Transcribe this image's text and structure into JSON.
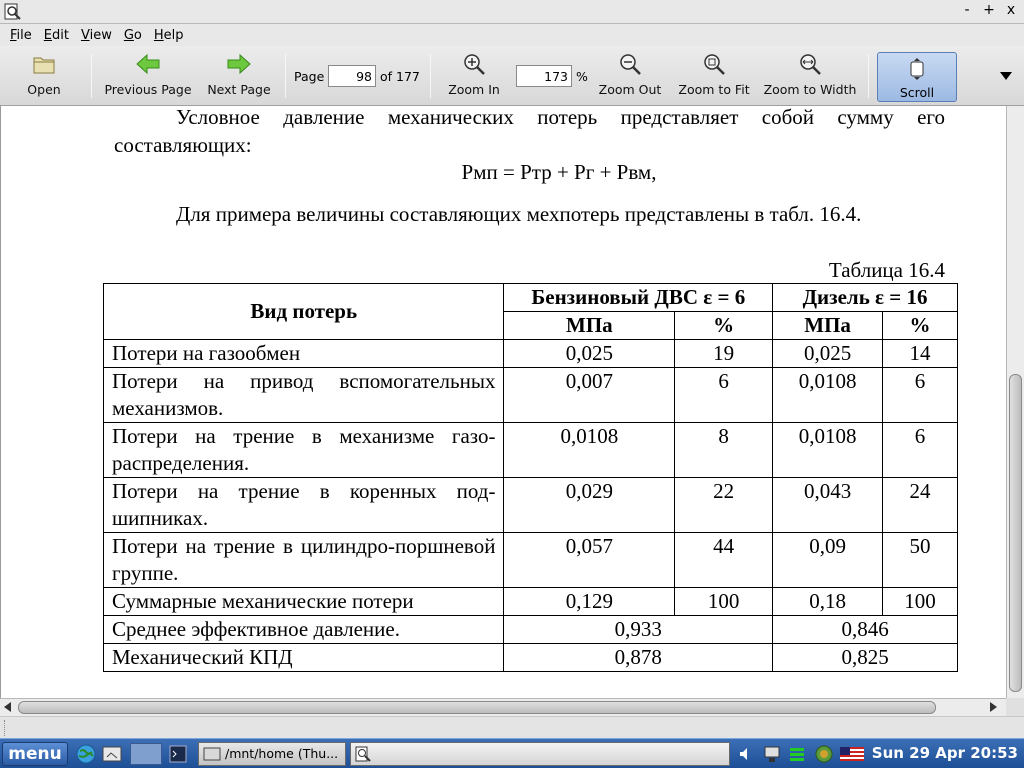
{
  "window": {
    "controls": [
      "-",
      "+",
      "x"
    ]
  },
  "menubar": {
    "items": [
      {
        "key": "F",
        "rest": "ile"
      },
      {
        "key": "E",
        "rest": "dit"
      },
      {
        "key": "V",
        "rest": "iew"
      },
      {
        "key": "G",
        "rest": "o"
      },
      {
        "key": "H",
        "rest": "elp"
      }
    ]
  },
  "toolbar": {
    "open": "Open",
    "previous_page": "Previous Page",
    "next_page": "Next Page",
    "page_label": "Page",
    "page_value": "98",
    "page_of": "of 177",
    "zoom_in": "Zoom In",
    "zoom_value": "173",
    "zoom_unit": "%",
    "zoom_out": "Zoom Out",
    "zoom_to_fit": "Zoom to Fit",
    "zoom_to_width": "Zoom to Width",
    "scroll": "Scroll"
  },
  "document": {
    "para1": "Условное давление механических потерь представляет собой сумму его составляющих:",
    "formula": "Рмп = Ртр + Рг + Рвм,",
    "para2": "Для примера величины составляющих мехпотерь представлены в табл. 16.4.",
    "table_caption": "Таблица 16.4",
    "table": {
      "header_loss_type": "Вид потерь",
      "header_petrol": "Бензиновый ДВС ε = 6",
      "header_diesel": "Дизель   ε = 16",
      "unit_mpa": "МПа",
      "unit_pct": "%",
      "rows": [
        {
          "name": "Потери на газообмен",
          "p_mpa": "0,025",
          "p_pct": "19",
          "d_mpa": "0,025",
          "d_pct": "14"
        },
        {
          "name": "Потери на привод вспомогательных механизмов.",
          "p_mpa": "0,007",
          "p_pct": "6",
          "d_mpa": "0,0108",
          "d_pct": "6"
        },
        {
          "name": "Потери на трение в механизме газо-распределения.",
          "p_mpa": "0,0108",
          "p_pct": "8",
          "d_mpa": "0,0108",
          "d_pct": "6"
        },
        {
          "name": "Потери на трение в коренных под-шипниках.",
          "p_mpa": "0,029",
          "p_pct": "22",
          "d_mpa": "0,043",
          "d_pct": "24"
        },
        {
          "name": "Потери на трение в цилиндро-поршневой группе.",
          "p_mpa": "0,057",
          "p_pct": "44",
          "d_mpa": "0,09",
          "d_pct": "50"
        },
        {
          "name": "Суммарные механические потери",
          "p_mpa": "0,129",
          "p_pct": "100",
          "d_mpa": "0,18",
          "d_pct": "100"
        }
      ],
      "merged_rows": [
        {
          "name": "Среднее эффективное давление.",
          "petrol": "0,933",
          "diesel": "0,846"
        },
        {
          "name": "Механический КПД",
          "petrol": "0,878",
          "diesel": "0,825"
        }
      ]
    }
  },
  "taskbar": {
    "menu_label": "menu",
    "task_terminal": "/mnt/home (Thu...",
    "task_viewer": "",
    "clock": "Sun 29 Apr 20:53"
  },
  "colors": {
    "accent": "#9cb9e3",
    "taskbar": "#2a5aa3"
  }
}
